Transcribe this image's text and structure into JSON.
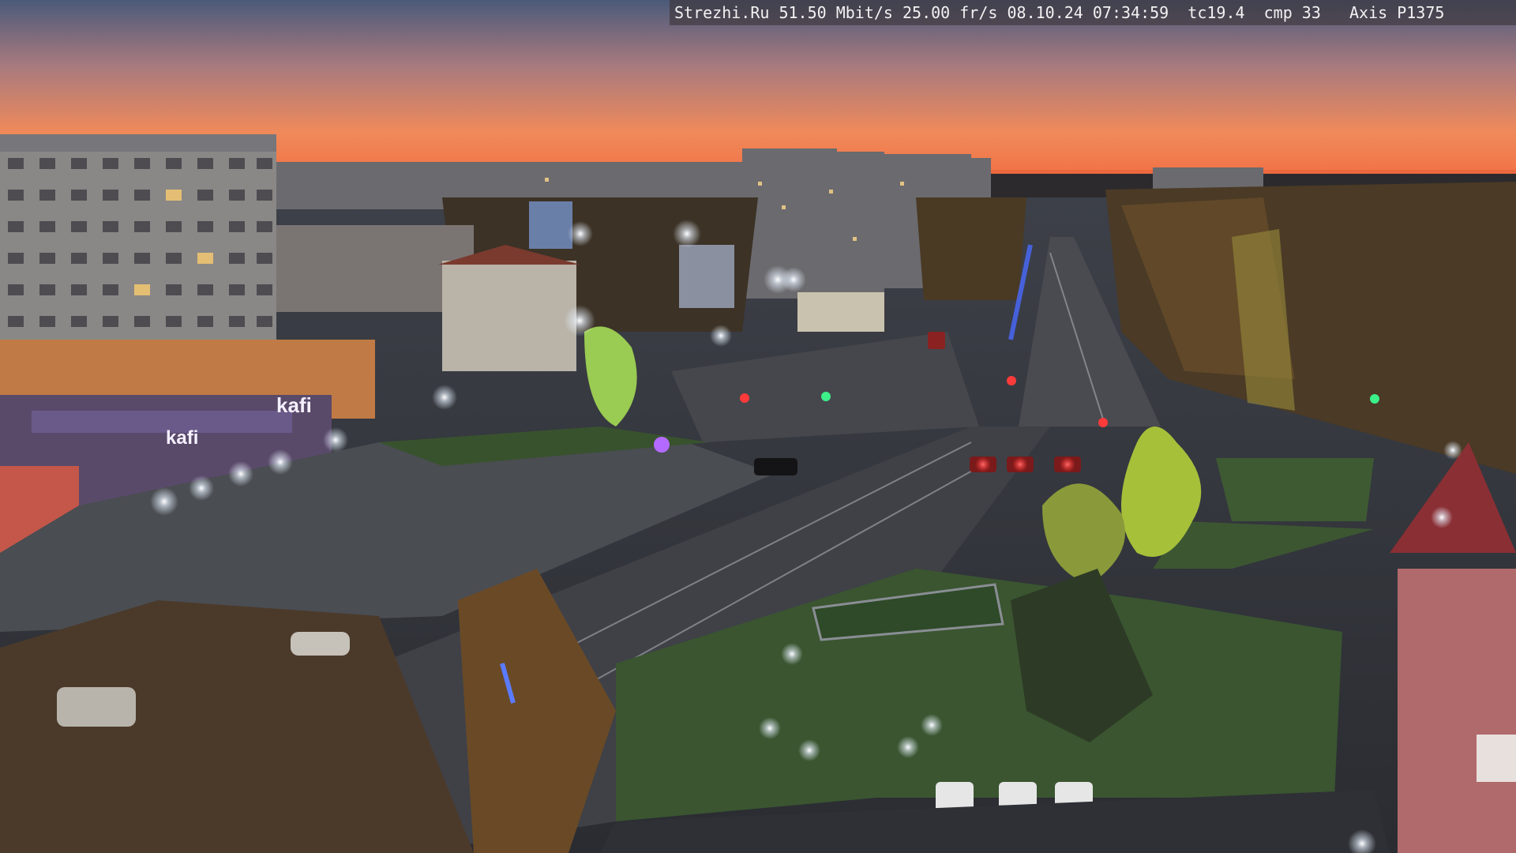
{
  "overlay": {
    "source": "Strezhi.Ru",
    "bitrate": "51.50 Mbit/s",
    "framerate": "25.00 fr/s",
    "date": "08.10.24",
    "time": "07:34:59",
    "tc": "tc19.4",
    "cmp": "cmp 33",
    "camera": "Axis P1375"
  },
  "signage": {
    "store_sign": "kafi"
  }
}
